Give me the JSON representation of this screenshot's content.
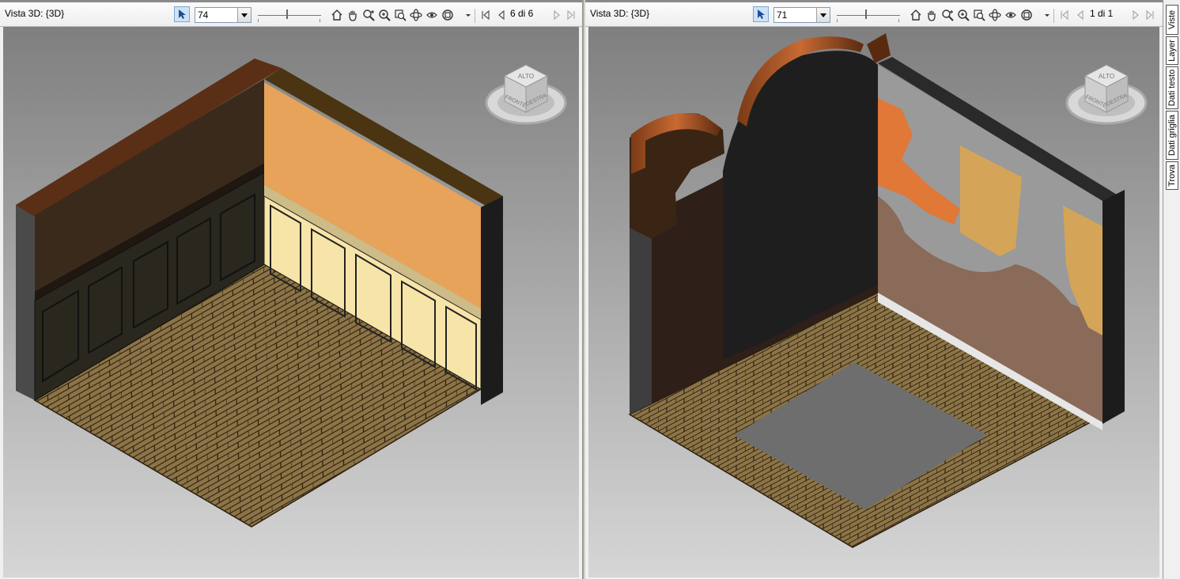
{
  "left_view": {
    "title": "Vista 3D: {3D}",
    "zoom_value": "74",
    "page_indicator": "6 di 6"
  },
  "right_view": {
    "title": "Vista 3D: {3D}",
    "zoom_value": "71",
    "page_indicator": "1 di 1"
  },
  "viewcube": {
    "top_label": "ALTO",
    "front_label": "FRONTE",
    "right_label": "DESTRA"
  },
  "sidebar_tabs": [
    "Viste",
    "Layer",
    "Dati testo",
    "Dati griglia",
    "Trova"
  ],
  "toolbar_icons": [
    "select-arrow-icon",
    "home-icon",
    "pan-hand-icon",
    "zoom-in-icon",
    "zoom-window-icon",
    "zoom-extents-icon",
    "orbit-icon",
    "walk-icon",
    "fit-icon",
    "dropdown-arrow-icon",
    "first-page-icon",
    "prev-page-icon",
    "next-page-icon",
    "last-page-icon"
  ],
  "colors": {
    "toolbar_bg": "#f0f0f0",
    "select_active": "#cfe3f5",
    "floor_tile": "#8c7446",
    "wall_dark": "#3a2a1c",
    "wall_orange": "#e7a35a",
    "wainscot_light": "#f7e4a8",
    "wall_slab": "#4a4a4a"
  }
}
